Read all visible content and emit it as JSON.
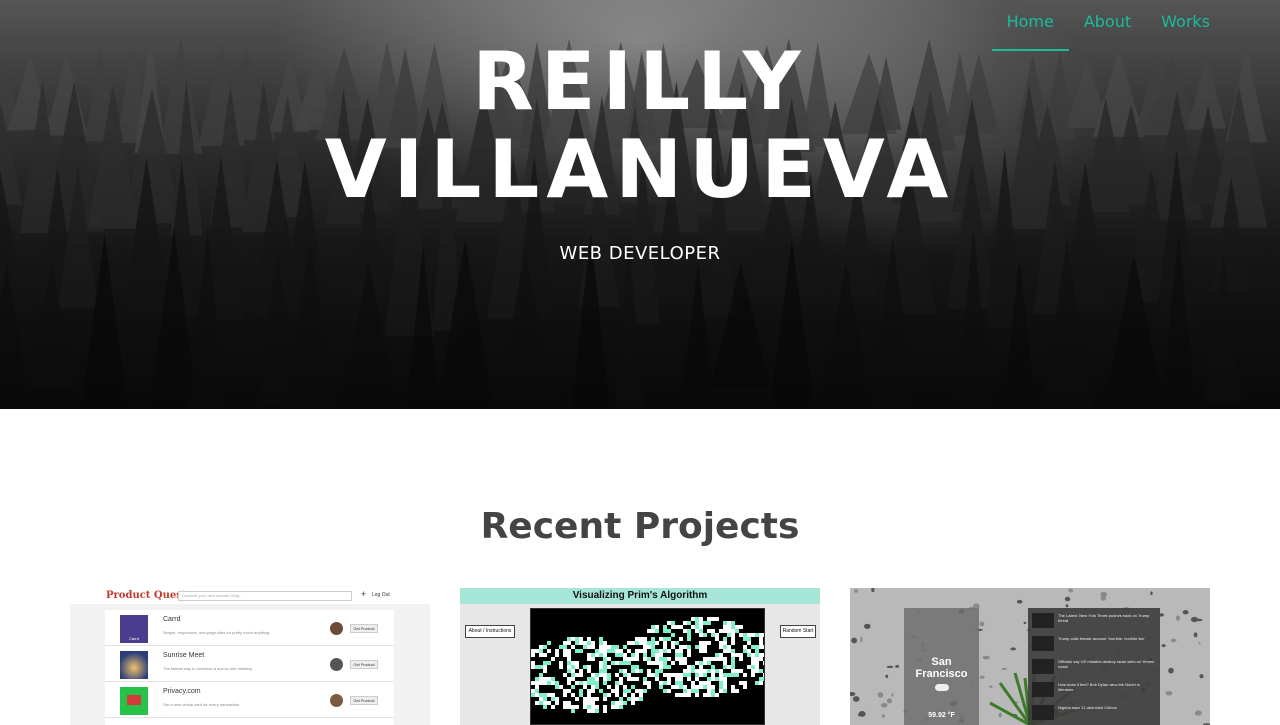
{
  "nav": {
    "items": [
      {
        "label": "Home",
        "active": true
      },
      {
        "label": "About",
        "active": false
      },
      {
        "label": "Works",
        "active": false
      }
    ],
    "accent_color": "#1abc9c"
  },
  "hero": {
    "title_line1": "REILLY",
    "title_line2": "VILLANUEVA",
    "subtitle": "WEB DEVELOPER"
  },
  "projects": {
    "heading": "Recent Projects",
    "cards": [
      {
        "app_title": "Product Quest",
        "search_placeholder": "Discover your next favorite thing...",
        "logout_label": "Log Out",
        "items": [
          {
            "name": "Carrd",
            "thumb_label": "Carrd",
            "description": "Simple, responsive, one-page sites for pretty much anything.",
            "button": "Get Product"
          },
          {
            "name": "Sunrise Meet",
            "description": "The fastest way to schedule a one-to-one meeting",
            "button": "Get Product"
          },
          {
            "name": "Privacy.com",
            "description": "Get a new virtual card for every transaction",
            "button": "Get Product"
          }
        ]
      },
      {
        "app_title": "Visualizing Prim's Algorithm",
        "left_button": "About / Instructions",
        "right_button": "Random Start"
      },
      {
        "city": "San Francisco",
        "temperature": "59.92 °F",
        "news": [
          "The Latest: New York Times pushes back on Trump threat",
          "Trump calls female accuser 'horrible, horrible liar'",
          "Officials say US missiles destroy radar sites on Yemen coast",
          "How does it feel? Bob Dylan wins the Nobel in literature",
          "Nigeria says 21 abducted Chibok"
        ]
      }
    ]
  }
}
